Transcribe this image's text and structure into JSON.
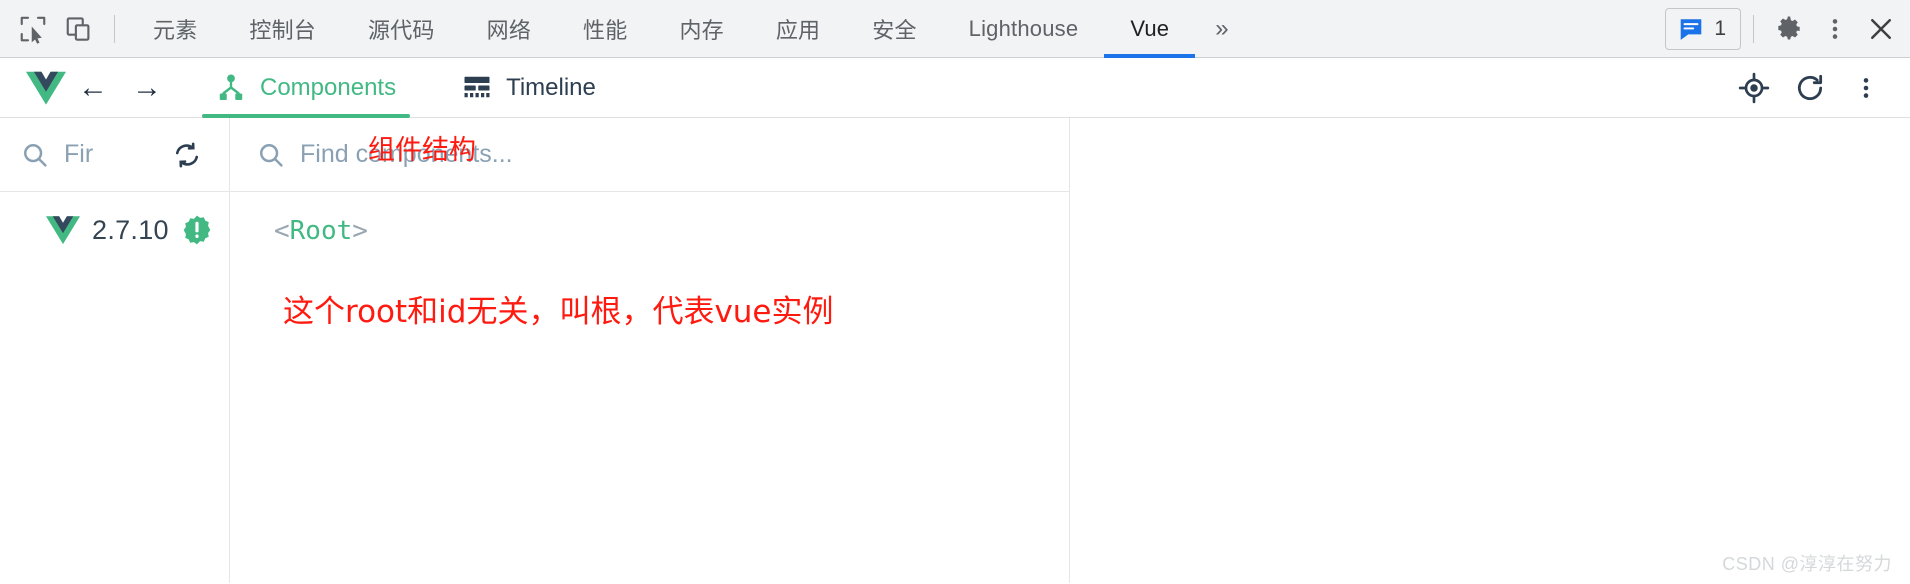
{
  "devtools": {
    "left_icons": [
      {
        "name": "inspect-element-icon",
        "label": "Inspect element"
      },
      {
        "name": "device-toolbar-icon",
        "label": "Toggle device toolbar"
      }
    ],
    "tabs": [
      {
        "label": "元素",
        "active": false
      },
      {
        "label": "控制台",
        "active": false
      },
      {
        "label": "源代码",
        "active": false
      },
      {
        "label": "网络",
        "active": false
      },
      {
        "label": "性能",
        "active": false
      },
      {
        "label": "内存",
        "active": false
      },
      {
        "label": "应用",
        "active": false
      },
      {
        "label": "安全",
        "active": false
      },
      {
        "label": "Lighthouse",
        "active": false
      },
      {
        "label": "Vue",
        "active": true
      }
    ],
    "overflow_label": "»",
    "messages": {
      "icon": "message-icon",
      "count": "1"
    },
    "settings_label": "gear-icon",
    "more_label": "kebab-menu-icon",
    "close_label": "close-icon",
    "active_tab_color": "#1a73e8"
  },
  "vue_toolbar": {
    "logo": "vue-logo",
    "back_label": "←",
    "forward_label": "→",
    "tabs": [
      {
        "label": "Components",
        "icon": "components-tree-icon",
        "active": true
      },
      {
        "label": "Timeline",
        "icon": "timeline-icon",
        "active": false
      }
    ],
    "right_icons": [
      {
        "name": "select-component-icon"
      },
      {
        "name": "refresh-icon"
      },
      {
        "name": "kebab-menu-icon"
      }
    ],
    "accent_color": "#42b983",
    "dark_color": "#2c3e50"
  },
  "left_panel": {
    "search": {
      "placeholder": "Fir",
      "icon": "search-icon"
    },
    "sync_icon": "sync-icon",
    "version": "2.7.10",
    "badge": {
      "icon": "warning-badge-icon",
      "symbol": "!",
      "color": "#42b983"
    }
  },
  "components_panel": {
    "search": {
      "placeholder": "Find components...",
      "icon": "search-icon"
    },
    "tree": [
      {
        "open_bracket": "<",
        "name": "Root",
        "close_bracket": ">"
      }
    ]
  },
  "annotations": [
    {
      "id": "annot-structure",
      "text": "组件结构"
    },
    {
      "id": "annot-root",
      "text": "这个root和id无关，叫根，代表vue实例"
    }
  ],
  "watermark": "CSDN @淳淳在努力"
}
